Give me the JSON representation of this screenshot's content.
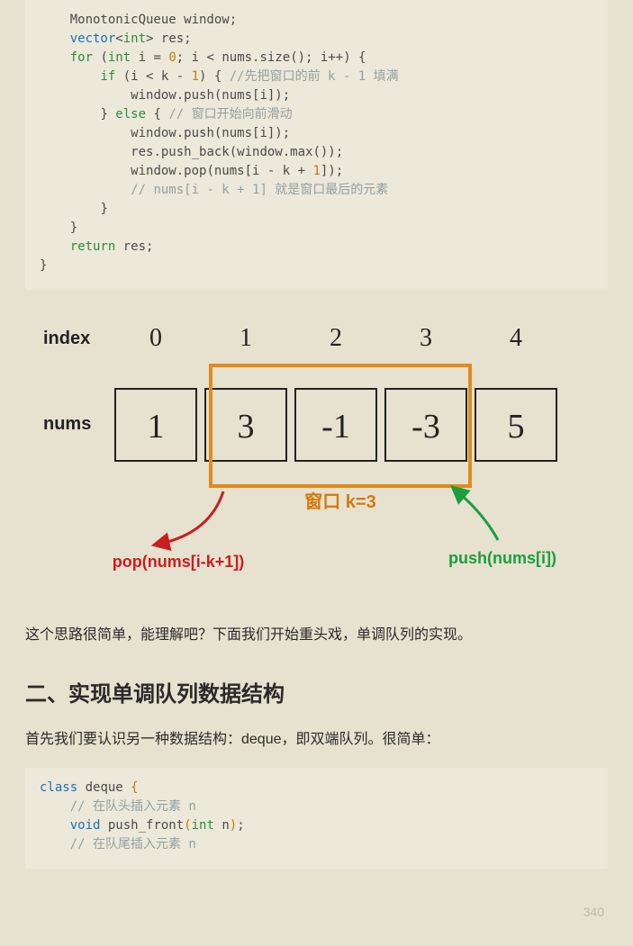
{
  "code1": {
    "l1": "MonotonicQueue window;",
    "l2a": "vector",
    "l2b": "<",
    "l2c": "int",
    "l2d": "> res;",
    "l3a": "for",
    "l3b": " (",
    "l3c": "int",
    "l3d": " i = ",
    "l3e": "0",
    "l3f": "; i < nums.size(); i++) {",
    "l4a": "if",
    "l4b": " (i < k - ",
    "l4c": "1",
    "l4d": ") { ",
    "l4e": "//先把窗口的前 k - 1 填满",
    "l5": "window.push(nums[i]);",
    "l6a": "} ",
    "l6b": "else",
    "l6c": " { ",
    "l6d": "// 窗口开始向前滑动",
    "l7": "window.push(nums[i]);",
    "l8": "res.push_back(window.max());",
    "l9a": "window.pop(nums[i - k + ",
    "l9b": "1",
    "l9c": "]);",
    "l10": "// nums[i - k + 1] 就是窗口最后的元素",
    "l11": "}",
    "l12": "}",
    "l13a": "return",
    "l13b": " res;",
    "l14": "}"
  },
  "diagram": {
    "label_index": "index",
    "label_nums": "nums",
    "indices": [
      "0",
      "1",
      "2",
      "3",
      "4"
    ],
    "values": [
      "1",
      "3",
      "-1",
      "-3",
      "5"
    ],
    "window_label": "窗口 k=3",
    "pop_label": "pop(nums[i-k+1])",
    "push_label": "push(nums[i])"
  },
  "para1": "这个思路很简单，能理解吧？下面我们开始重头戏，单调队列的实现。",
  "heading2": "二、实现单调队列数据结构",
  "para2": "首先我们要认识另一种数据结构：deque，即双端队列。很简单：",
  "code2": {
    "l1a": "class",
    "l1b": " deque ",
    "l1c": "{",
    "l2": "// 在队头插入元素 n",
    "l3a": "void",
    "l3b": " push_front",
    "l3c": "(",
    "l3d": "int",
    "l3e": " n",
    "l3f": ")",
    "l3g": ";",
    "l4": "// 在队尾插入元素 n"
  },
  "page_num": "340"
}
